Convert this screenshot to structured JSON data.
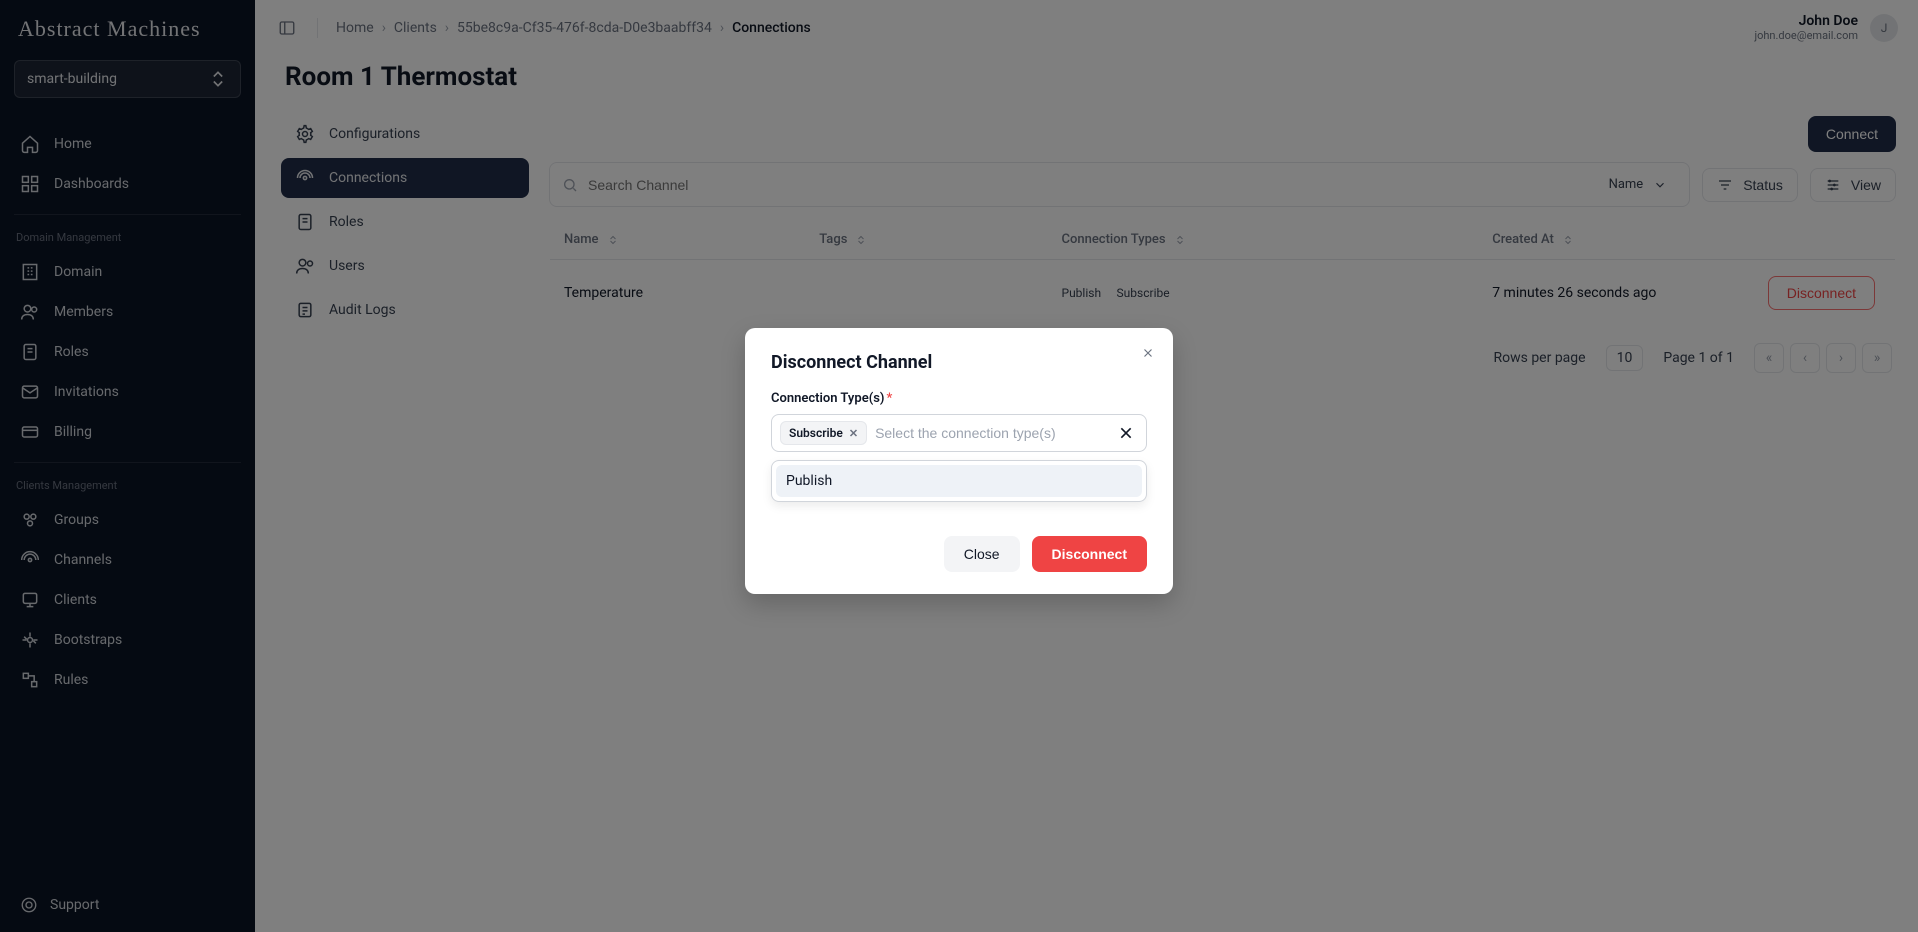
{
  "brand": "Abstract Machines",
  "workspace": "smart-building",
  "nav_main": [
    {
      "label": "Home",
      "icon": "home-icon"
    },
    {
      "label": "Dashboards",
      "icon": "dashboards-icon"
    }
  ],
  "nav_sections": [
    {
      "heading": "Domain Management",
      "items": [
        {
          "label": "Domain",
          "icon": "domain-icon"
        },
        {
          "label": "Members",
          "icon": "members-icon"
        },
        {
          "label": "Roles",
          "icon": "roles-icon"
        },
        {
          "label": "Invitations",
          "icon": "invitations-icon"
        },
        {
          "label": "Billing",
          "icon": "billing-icon"
        }
      ]
    },
    {
      "heading": "Clients Management",
      "items": [
        {
          "label": "Groups",
          "icon": "groups-icon"
        },
        {
          "label": "Channels",
          "icon": "channels-icon"
        },
        {
          "label": "Clients",
          "icon": "clients-icon"
        },
        {
          "label": "Bootstraps",
          "icon": "bootstraps-icon"
        },
        {
          "label": "Rules",
          "icon": "rules-icon"
        }
      ]
    }
  ],
  "support_label": "Support",
  "breadcrumbs": [
    "Home",
    "Clients",
    "55be8c9a-Cf35-476f-8cda-D0e3baabff34",
    "Connections"
  ],
  "user": {
    "name": "John Doe",
    "email": "john.doe@email.com",
    "initial": "J"
  },
  "page_title": "Room 1 Thermostat",
  "sub_tabs": [
    {
      "label": "Configurations",
      "icon": "gear-icon"
    },
    {
      "label": "Connections",
      "icon": "broadcast-icon"
    },
    {
      "label": "Roles",
      "icon": "scroll-icon"
    },
    {
      "label": "Users",
      "icon": "users-icon"
    },
    {
      "label": "Audit Logs",
      "icon": "log-icon"
    }
  ],
  "connect_button": "Connect",
  "search_placeholder": "Search Channel",
  "search_scope": "Name",
  "status_button": "Status",
  "view_button": "View",
  "table": {
    "columns": [
      "Name",
      "Tags",
      "Connection Types",
      "Created At",
      ""
    ],
    "rows": [
      {
        "name": "Temperature",
        "tags": "",
        "types": [
          "Publish",
          "Subscribe"
        ],
        "created": "7 minutes 26 seconds ago",
        "action": "Disconnect"
      }
    ]
  },
  "pagination": {
    "rows_label": "Rows per page",
    "rows": "10",
    "page_label": "Page 1 of 1"
  },
  "modal": {
    "title": "Disconnect Channel",
    "field_label": "Connection Type(s)",
    "selected_chip": "Subscribe",
    "placeholder": "Select the connection type(s)",
    "option": "Publish",
    "close": "Close",
    "disconnect": "Disconnect"
  }
}
